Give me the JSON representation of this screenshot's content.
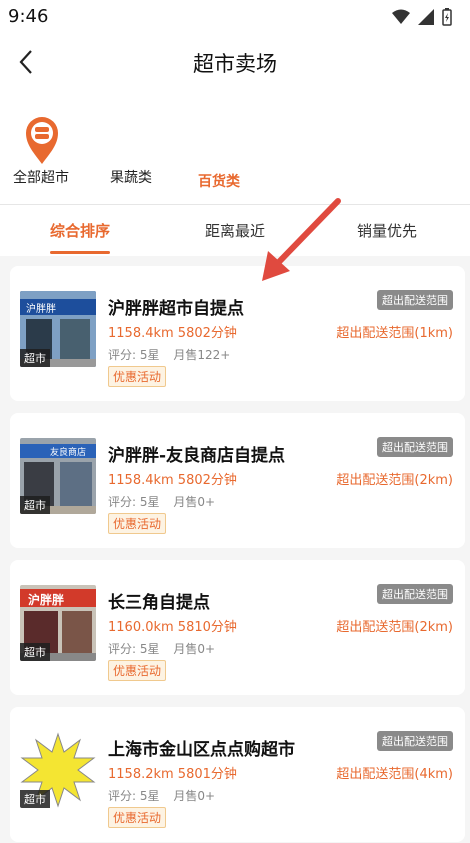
{
  "status": {
    "time": "9:46"
  },
  "nav": {
    "title": "超市卖场"
  },
  "categories": [
    {
      "label": "全部超市",
      "active": false
    },
    {
      "label": "果蔬类",
      "active": false
    },
    {
      "label": "百货类",
      "active": true
    }
  ],
  "tabs": [
    {
      "label": "综合排序",
      "active": true
    },
    {
      "label": "距离最近",
      "active": false
    },
    {
      "label": "销量优先",
      "active": false
    }
  ],
  "stores": [
    {
      "name": "沪胖胖超市自提点",
      "distance": "1158.4km 5802分钟",
      "rating": "评分: 5星",
      "sales": "月售122+",
      "promo": "优惠活动",
      "badge": "超出配送范围",
      "range": "超出配送范围(1km)",
      "thumb_label": "超市",
      "thumb_text": "沪胖胖"
    },
    {
      "name": "沪胖胖-友良商店自提点",
      "distance": "1158.4km 5802分钟",
      "rating": "评分: 5星",
      "sales": "月售0+",
      "promo": "优惠活动",
      "badge": "超出配送范围",
      "range": "超出配送范围(2km)",
      "thumb_label": "超市",
      "thumb_text": "友良商店"
    },
    {
      "name": "长三角自提点",
      "distance": "1160.0km 5810分钟",
      "rating": "评分: 5星",
      "sales": "月售0+",
      "promo": "优惠活动",
      "badge": "超出配送范围",
      "range": "超出配送范围(2km)",
      "thumb_label": "超市",
      "thumb_text": "沪胖胖"
    },
    {
      "name": "上海市金山区点点购超市",
      "distance": "1158.2km 5801分钟",
      "rating": "评分: 5星",
      "sales": "月售0+",
      "promo": "优惠活动",
      "badge": "超出配送范围",
      "range": "超出配送范围(4km)",
      "thumb_label": "超市",
      "thumb_text": ""
    }
  ],
  "colors": {
    "accent": "#e8692f",
    "badge": "#8a8a8a"
  }
}
